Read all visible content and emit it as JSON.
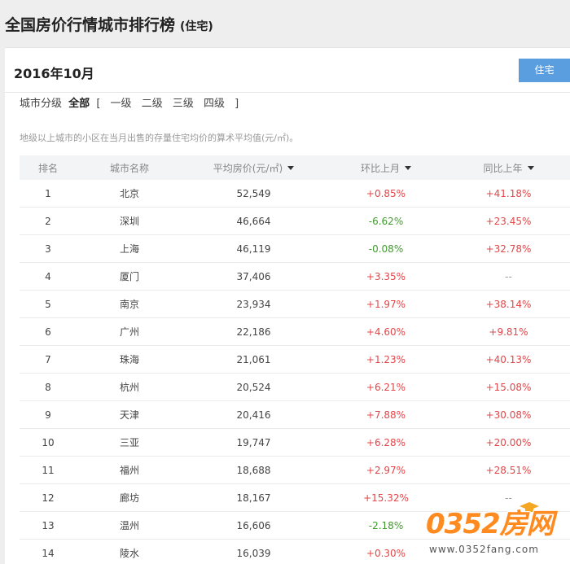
{
  "header": {
    "title": "全国房价行情城市排行榜",
    "subtitle": "(住宅)"
  },
  "panel": {
    "month": "2016年10月",
    "type_button": "住宅"
  },
  "filter": {
    "label": "城市分级",
    "active": "全部",
    "bracket_open": "[",
    "bracket_close": "]",
    "levels": [
      "一级",
      "二级",
      "三级",
      "四级"
    ]
  },
  "note": "地级以上城市的小区在当月出售的存量住宅均价的算术平均值(元/㎡)。",
  "table": {
    "columns": [
      "排名",
      "城市名称",
      "平均房价(元/㎡)",
      "环比上月",
      "同比上年"
    ],
    "rows": [
      {
        "rank": "1",
        "city": "北京",
        "price": "52,549",
        "mom": "+0.85%",
        "yoy": "+41.18%"
      },
      {
        "rank": "2",
        "city": "深圳",
        "price": "46,664",
        "mom": "-6.62%",
        "yoy": "+23.45%"
      },
      {
        "rank": "3",
        "city": "上海",
        "price": "46,119",
        "mom": "-0.08%",
        "yoy": "+32.78%"
      },
      {
        "rank": "4",
        "city": "厦门",
        "price": "37,406",
        "mom": "+3.35%",
        "yoy": "--"
      },
      {
        "rank": "5",
        "city": "南京",
        "price": "23,934",
        "mom": "+1.97%",
        "yoy": "+38.14%"
      },
      {
        "rank": "6",
        "city": "广州",
        "price": "22,186",
        "mom": "+4.60%",
        "yoy": "+9.81%"
      },
      {
        "rank": "7",
        "city": "珠海",
        "price": "21,061",
        "mom": "+1.23%",
        "yoy": "+40.13%"
      },
      {
        "rank": "8",
        "city": "杭州",
        "price": "20,524",
        "mom": "+6.21%",
        "yoy": "+15.08%"
      },
      {
        "rank": "9",
        "city": "天津",
        "price": "20,416",
        "mom": "+7.88%",
        "yoy": "+30.08%"
      },
      {
        "rank": "10",
        "city": "三亚",
        "price": "19,747",
        "mom": "+6.28%",
        "yoy": "+20.00%"
      },
      {
        "rank": "11",
        "city": "福州",
        "price": "18,688",
        "mom": "+2.97%",
        "yoy": "+28.51%"
      },
      {
        "rank": "12",
        "city": "廊坊",
        "price": "18,167",
        "mom": "+15.32%",
        "yoy": "--"
      },
      {
        "rank": "13",
        "city": "温州",
        "price": "16,606",
        "mom": "-2.18%",
        "yoy": ""
      },
      {
        "rank": "14",
        "city": "陵水",
        "price": "16,039",
        "mom": "+0.30%",
        "yoy": ""
      }
    ]
  },
  "watermark": {
    "logo": "0352房网",
    "url": "www.0352fang.com"
  },
  "colors": {
    "up": "#e2474a",
    "down": "#3f9c2c",
    "button": "#5b9ee0",
    "logo": "#ff8a1f"
  }
}
